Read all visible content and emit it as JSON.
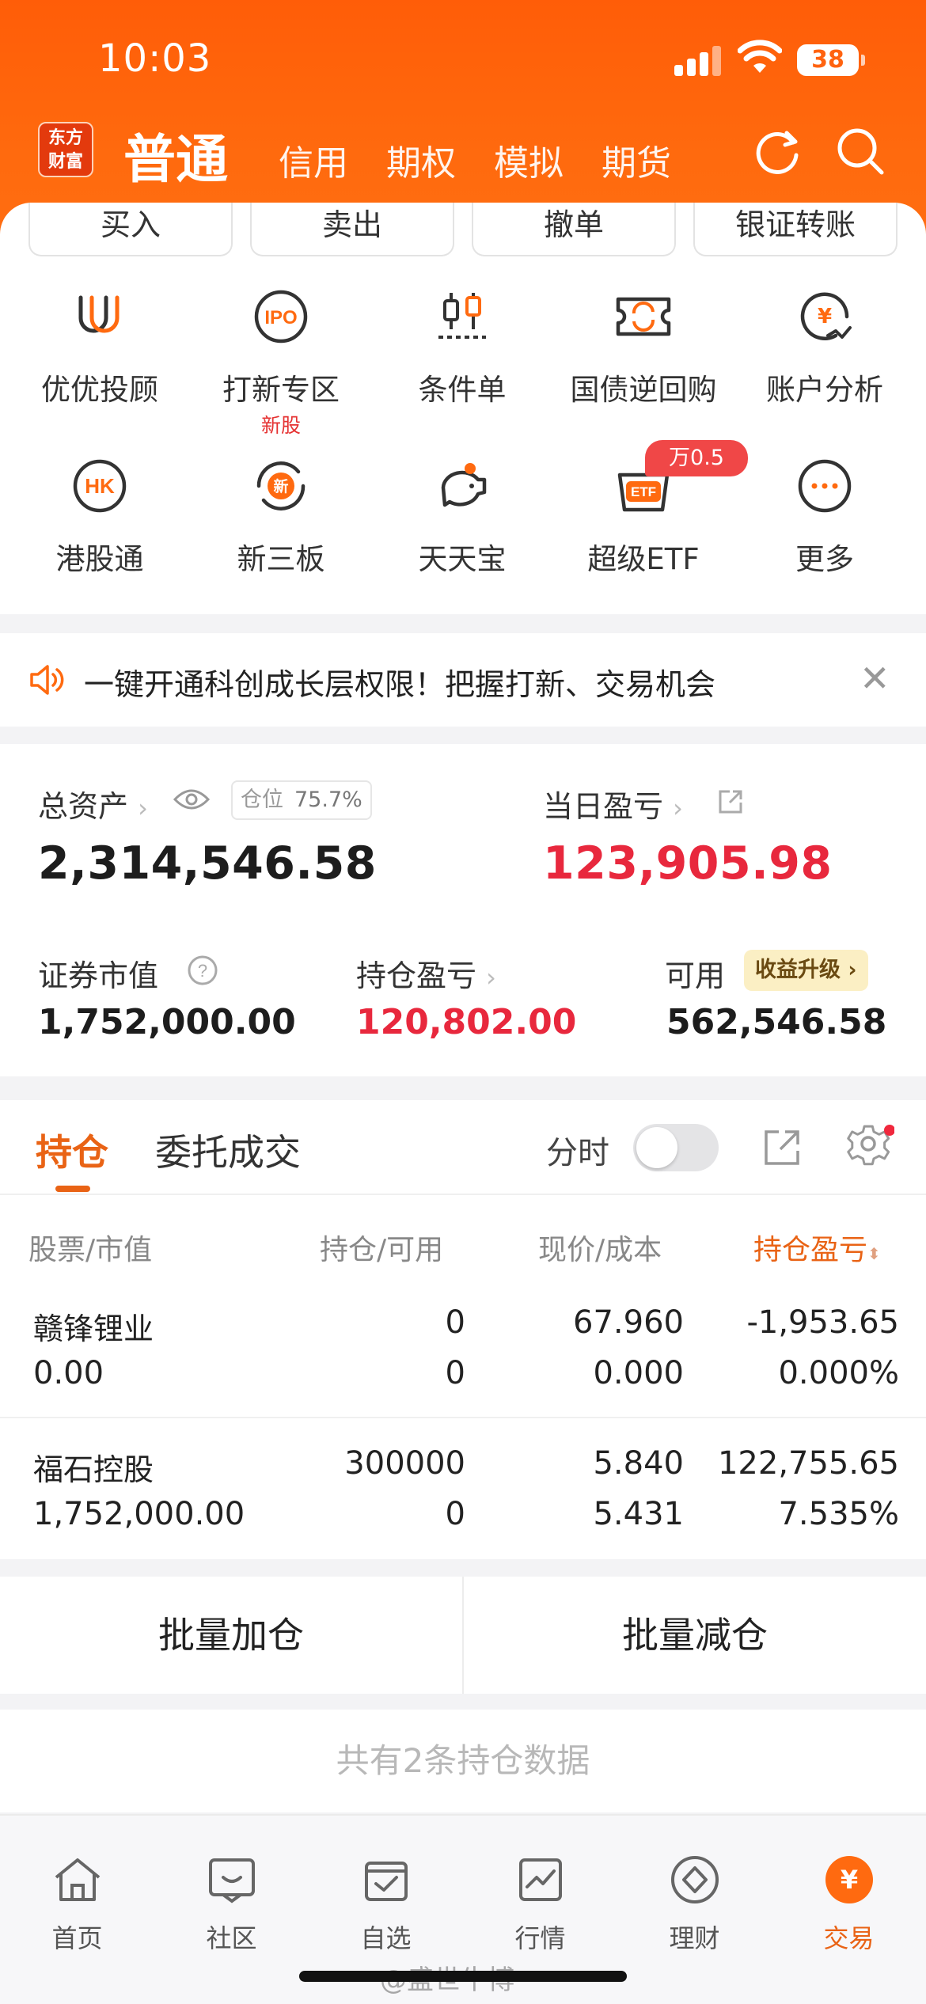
{
  "status_bar": {
    "time": "10:03",
    "battery": "38"
  },
  "nav": {
    "logo": "东方财富",
    "active": "普通",
    "tabs": [
      "信用",
      "期权",
      "模拟",
      "期货"
    ]
  },
  "quick_actions": [
    "买入",
    "卖出",
    "撤单",
    "银证转账"
  ],
  "features": [
    {
      "label": "优优投顾",
      "icon": "uu-advisor-icon"
    },
    {
      "label": "打新专区",
      "sub": "新股",
      "icon": "ipo-icon"
    },
    {
      "label": "条件单",
      "icon": "conditional-order-icon"
    },
    {
      "label": "国债逆回购",
      "icon": "reverse-repo-icon"
    },
    {
      "label": "账户分析",
      "icon": "account-analysis-icon"
    },
    {
      "label": "港股通",
      "icon": "hk-connect-icon"
    },
    {
      "label": "新三板",
      "icon": "neeq-icon"
    },
    {
      "label": "天天宝",
      "icon": "piggy-bank-icon"
    },
    {
      "label": "超级ETF",
      "icon": "etf-icon",
      "badge": "万0.5"
    },
    {
      "label": "更多",
      "icon": "more-icon"
    }
  ],
  "notice": {
    "text": "一键开通科创成长层权限！把握打新、交易机会"
  },
  "assets": {
    "total_label": "总资产",
    "position_label": "仓位",
    "position_value": "75.7%",
    "total_value": "2,314,546.58",
    "daily_pl_label": "当日盈亏",
    "daily_pl_value": "123,905.98",
    "market_value_label": "证券市值",
    "market_value": "1,752,000.00",
    "holding_pl_label": "持仓盈亏",
    "holding_pl_value": "120,802.00",
    "available_label": "可用",
    "upgrade_label": "收益升级",
    "available_value": "562,546.58"
  },
  "holdings": {
    "tab_active": "持仓",
    "tab_other": "委托成交",
    "toggle_label": "分时",
    "headers": {
      "stock": "股票",
      "market_value": "市值",
      "position": "持仓",
      "available": "可用",
      "price": "现价",
      "cost": "成本",
      "pl": "持仓盈亏"
    },
    "rows": [
      {
        "name": "赣锋锂业",
        "market_value": "0.00",
        "position": "0",
        "available": "0",
        "price": "67.960",
        "cost": "0.000",
        "pl": "-1,953.65",
        "pl_pct": "0.000%",
        "trend": "down"
      },
      {
        "name": "福石控股",
        "market_value": "1,752,000.00",
        "position": "300000",
        "available": "0",
        "price": "5.840",
        "cost": "5.431",
        "pl": "122,755.65",
        "pl_pct": "7.535%",
        "trend": "up"
      }
    ],
    "batch_add": "批量加仓",
    "batch_reduce": "批量减仓",
    "total_text": "共有2条持仓数据"
  },
  "bottom_nav": [
    {
      "label": "首页",
      "icon": "home-icon"
    },
    {
      "label": "社区",
      "icon": "community-icon"
    },
    {
      "label": "自选",
      "icon": "watchlist-icon"
    },
    {
      "label": "行情",
      "icon": "market-icon"
    },
    {
      "label": "理财",
      "icon": "wealth-icon"
    },
    {
      "label": "交易",
      "icon": "trade-icon",
      "active": true
    }
  ],
  "watermark": "@盛世牛博",
  "colors": {
    "brand": "#ff6310",
    "accent": "#e96315",
    "up": "#e8283d",
    "down": "#1aa832"
  }
}
